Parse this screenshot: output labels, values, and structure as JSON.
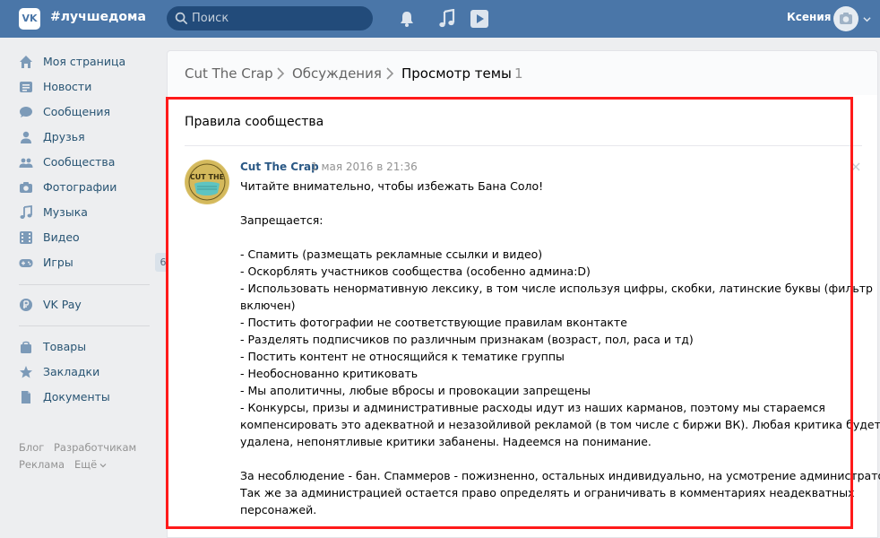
{
  "header": {
    "logo_text": "VK",
    "community": "#лучшедома",
    "search_placeholder": "Поиск",
    "user_name": "Ксения"
  },
  "sidebar": {
    "items": [
      {
        "label": "Моя страница",
        "icon": "home-icon"
      },
      {
        "label": "Новости",
        "icon": "news-icon"
      },
      {
        "label": "Сообщения",
        "icon": "messages-icon"
      },
      {
        "label": "Друзья",
        "icon": "friends-icon"
      },
      {
        "label": "Сообщества",
        "icon": "groups-icon"
      },
      {
        "label": "Фотографии",
        "icon": "camera-icon"
      },
      {
        "label": "Музыка",
        "icon": "music-note-icon"
      },
      {
        "label": "Видео",
        "icon": "film-icon"
      },
      {
        "label": "Игры",
        "icon": "gamepad-icon",
        "badge": "6"
      }
    ],
    "items2": [
      {
        "label": "VK Pay",
        "icon": "vkpay-icon"
      }
    ],
    "items3": [
      {
        "label": "Товары",
        "icon": "bag-icon"
      },
      {
        "label": "Закладки",
        "icon": "star-icon"
      },
      {
        "label": "Документы",
        "icon": "document-icon"
      }
    ],
    "footer": {
      "blog": "Блог",
      "developers": "Разработчикам",
      "ads": "Реклама",
      "more": "Ещё"
    }
  },
  "breadcrumb": {
    "community": "Cut The Crap",
    "section": "Обсуждения",
    "current": "Просмотр темы",
    "count": "1"
  },
  "topic": {
    "title": "Правила сообщества",
    "post": {
      "author": "Cut The Crap",
      "date": "1 мая 2016 в 21:36",
      "avatar_text": "CUT THE",
      "lines": [
        "Читайте внимательно, чтобы избежать Бана Соло!",
        "",
        "Запрещается:",
        "",
        "- Спамить (размещать рекламные ссылки и видео)",
        "- Оскорблять участников сообщества (особенно админа:D)",
        "- Использовать ненормативную лексику, в том числе используя цифры, скобки, латинские буквы (фильтр",
        "включен)",
        "- Постить фотографии не соответствующие правилам вконтакте",
        "- Разделять подписчиков по различным признакам (возраст, пол, раса и тд)",
        "- Постить контент не относящийся к тематике группы",
        "- Необоснованно критиковать",
        "- Мы аполитичны, любые вбросы и провокации запрещены",
        "- Конкурсы, призы и административные расходы идут из наших карманов, поэтому мы стараемся",
        "компенсировать это адекватной и незазойливой рекламой (в том числе с биржи ВК). Любая критика будет",
        "удалена, непонятливые критики забанены. Надеемся на понимание.",
        "",
        "За несоблюдение - бан. Спаммеров - пожизненно, остальных индивидуально, на усмотрение администратора.",
        "Так же за администрацией остается право определять и ограничивать в комментариях неадекватных",
        "персонажей."
      ]
    }
  },
  "colors": {
    "header": "#4a76a8",
    "link": "#2a5885",
    "highlight": "#ff1a1a"
  }
}
